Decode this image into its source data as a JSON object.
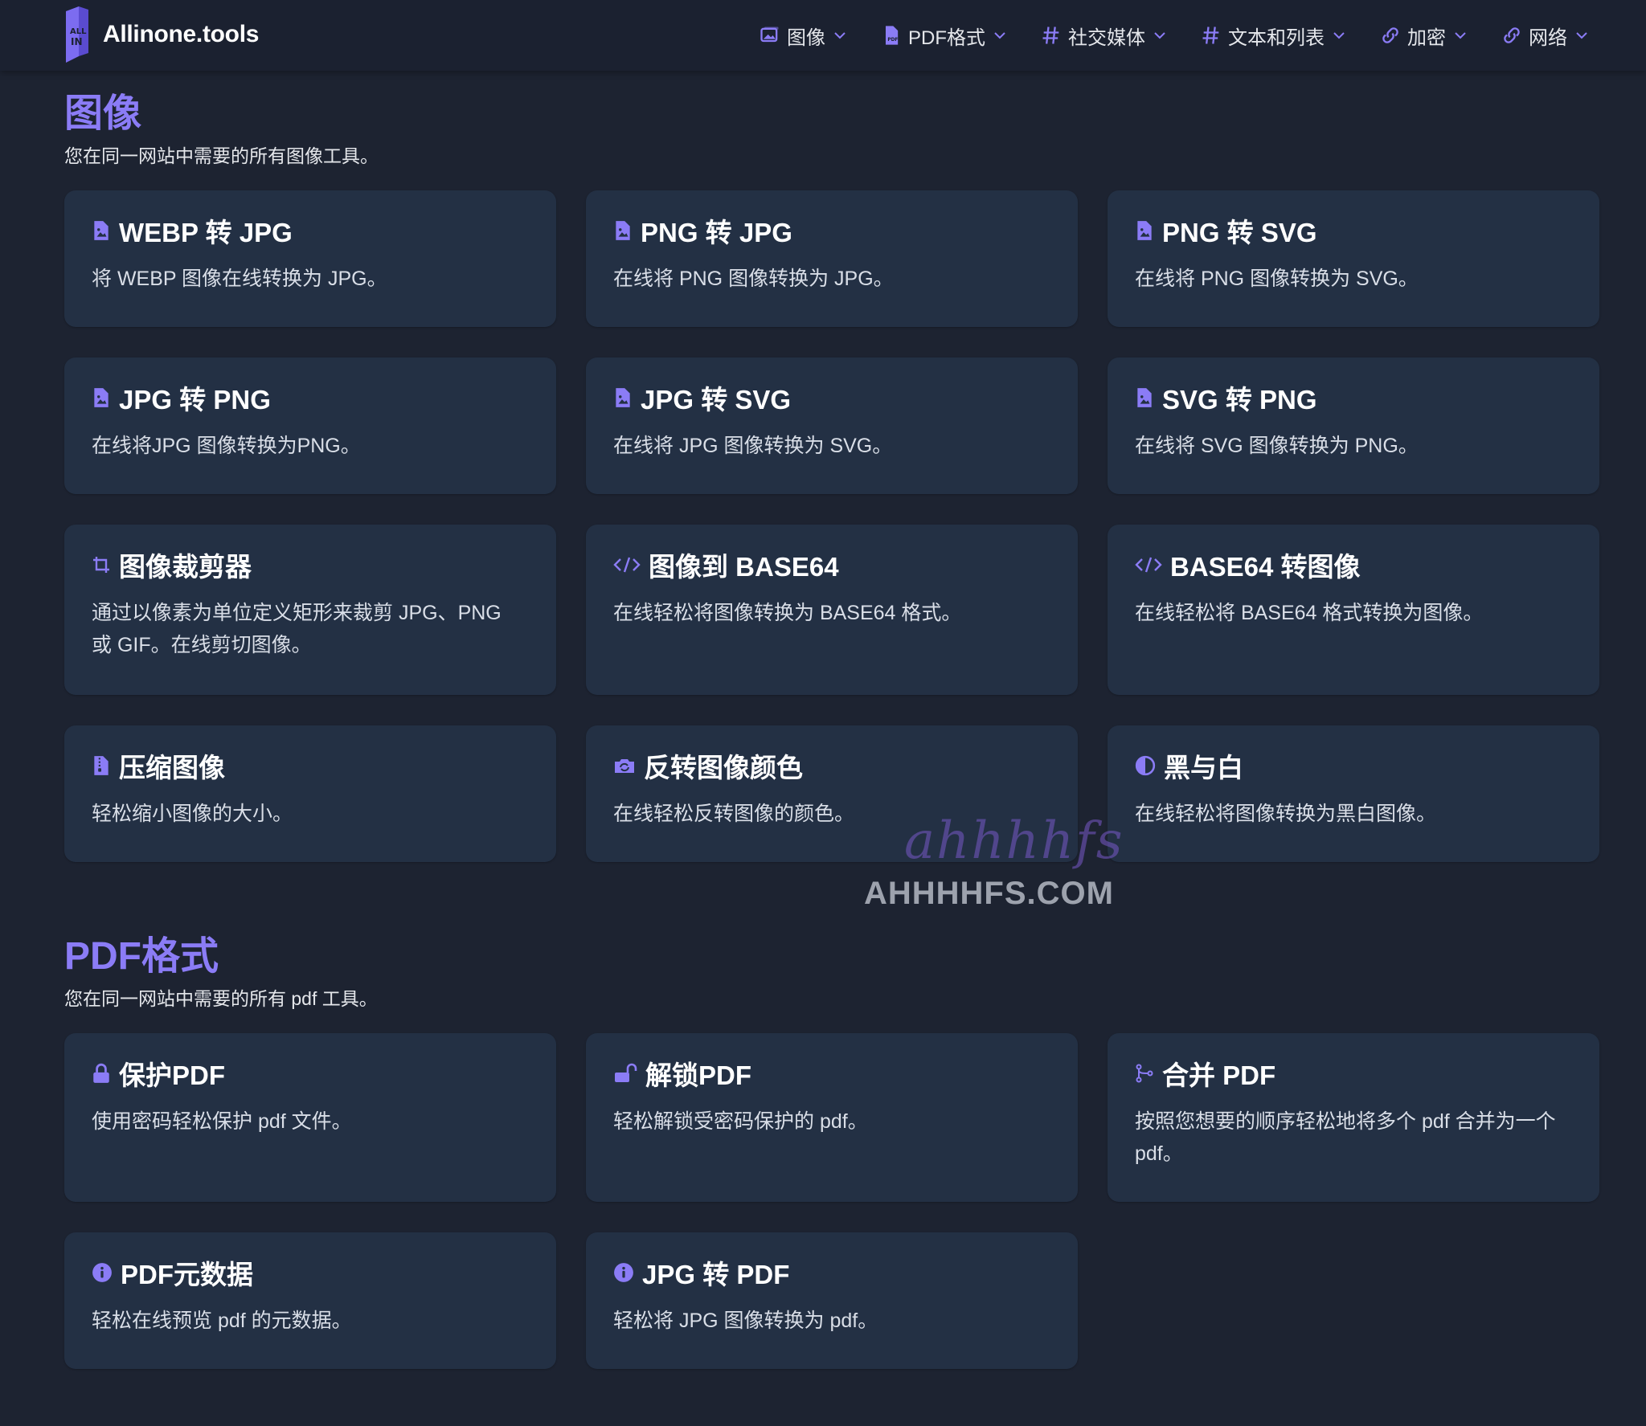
{
  "header": {
    "brand": "Allinone.tools",
    "nav": [
      {
        "label": "图像",
        "icon": "image-icon"
      },
      {
        "label": "PDF格式",
        "icon": "pdf-file-icon"
      },
      {
        "label": "社交媒体",
        "icon": "hashtag-icon"
      },
      {
        "label": "文本和列表",
        "icon": "hashtag-icon"
      },
      {
        "label": "加密",
        "icon": "link-icon"
      },
      {
        "label": "网络",
        "icon": "link-icon"
      }
    ]
  },
  "sections": [
    {
      "title": "图像",
      "subtitle": "您在同一网站中需要的所有图像工具。",
      "cards": [
        {
          "title": "WEBP 转 JPG",
          "desc": "将 WEBP 图像在线转换为 JPG。",
          "icon": "image-file-icon"
        },
        {
          "title": "PNG 转 JPG",
          "desc": "在线将 PNG 图像转换为 JPG。",
          "icon": "image-file-icon"
        },
        {
          "title": "PNG 转 SVG",
          "desc": "在线将 PNG 图像转换为 SVG。",
          "icon": "image-file-icon"
        },
        {
          "title": "JPG 转 PNG",
          "desc": "在线将JPG 图像转换为PNG。",
          "icon": "image-file-icon"
        },
        {
          "title": "JPG 转 SVG",
          "desc": "在线将 JPG 图像转换为 SVG。",
          "icon": "image-file-icon"
        },
        {
          "title": "SVG 转 PNG",
          "desc": "在线将 SVG 图像转换为 PNG。",
          "icon": "image-file-icon"
        },
        {
          "title": "图像裁剪器",
          "desc": "通过以像素为单位定义矩形来裁剪 JPG、PNG 或 GIF。在线剪切图像。",
          "icon": "crop-icon"
        },
        {
          "title": "图像到 BASE64",
          "desc": "在线轻松将图像转换为 BASE64 格式。",
          "icon": "code-icon"
        },
        {
          "title": "BASE64 转图像",
          "desc": "在线轻松将 BASE64 格式转换为图像。",
          "icon": "code-icon"
        },
        {
          "title": "压缩图像",
          "desc": "轻松缩小图像的大小。",
          "icon": "zip-file-icon"
        },
        {
          "title": "反转图像颜色",
          "desc": "在线轻松反转图像的颜色。",
          "icon": "camera-rotate-icon"
        },
        {
          "title": "黑与白",
          "desc": "在线轻松将图像转换为黑白图像。",
          "icon": "contrast-icon"
        }
      ]
    },
    {
      "title": "PDF格式",
      "subtitle": "您在同一网站中需要的所有 pdf 工具。",
      "cards": [
        {
          "title": "保护PDF",
          "desc": "使用密码轻松保护 pdf 文件。",
          "icon": "lock-icon"
        },
        {
          "title": "解锁PDF",
          "desc": "轻松解锁受密码保护的 pdf。",
          "icon": "unlock-icon"
        },
        {
          "title": "合并 PDF",
          "desc": "按照您想要的顺序轻松地将多个 pdf 合并为一个 pdf。",
          "icon": "merge-icon"
        },
        {
          "title": "PDF元数据",
          "desc": "轻松在线预览 pdf 的元数据。",
          "icon": "info-icon"
        },
        {
          "title": "JPG 转 PDF",
          "desc": "轻松将 JPG 图像转换为 pdf。",
          "icon": "info-icon"
        }
      ]
    }
  ],
  "watermark": {
    "script": "ahhhhfs",
    "domain": "AHHHHFS.COM"
  },
  "colors": {
    "accent": "#8b7cf6",
    "background": "#1d2331",
    "card": "#233044",
    "header": "#1b2130"
  }
}
